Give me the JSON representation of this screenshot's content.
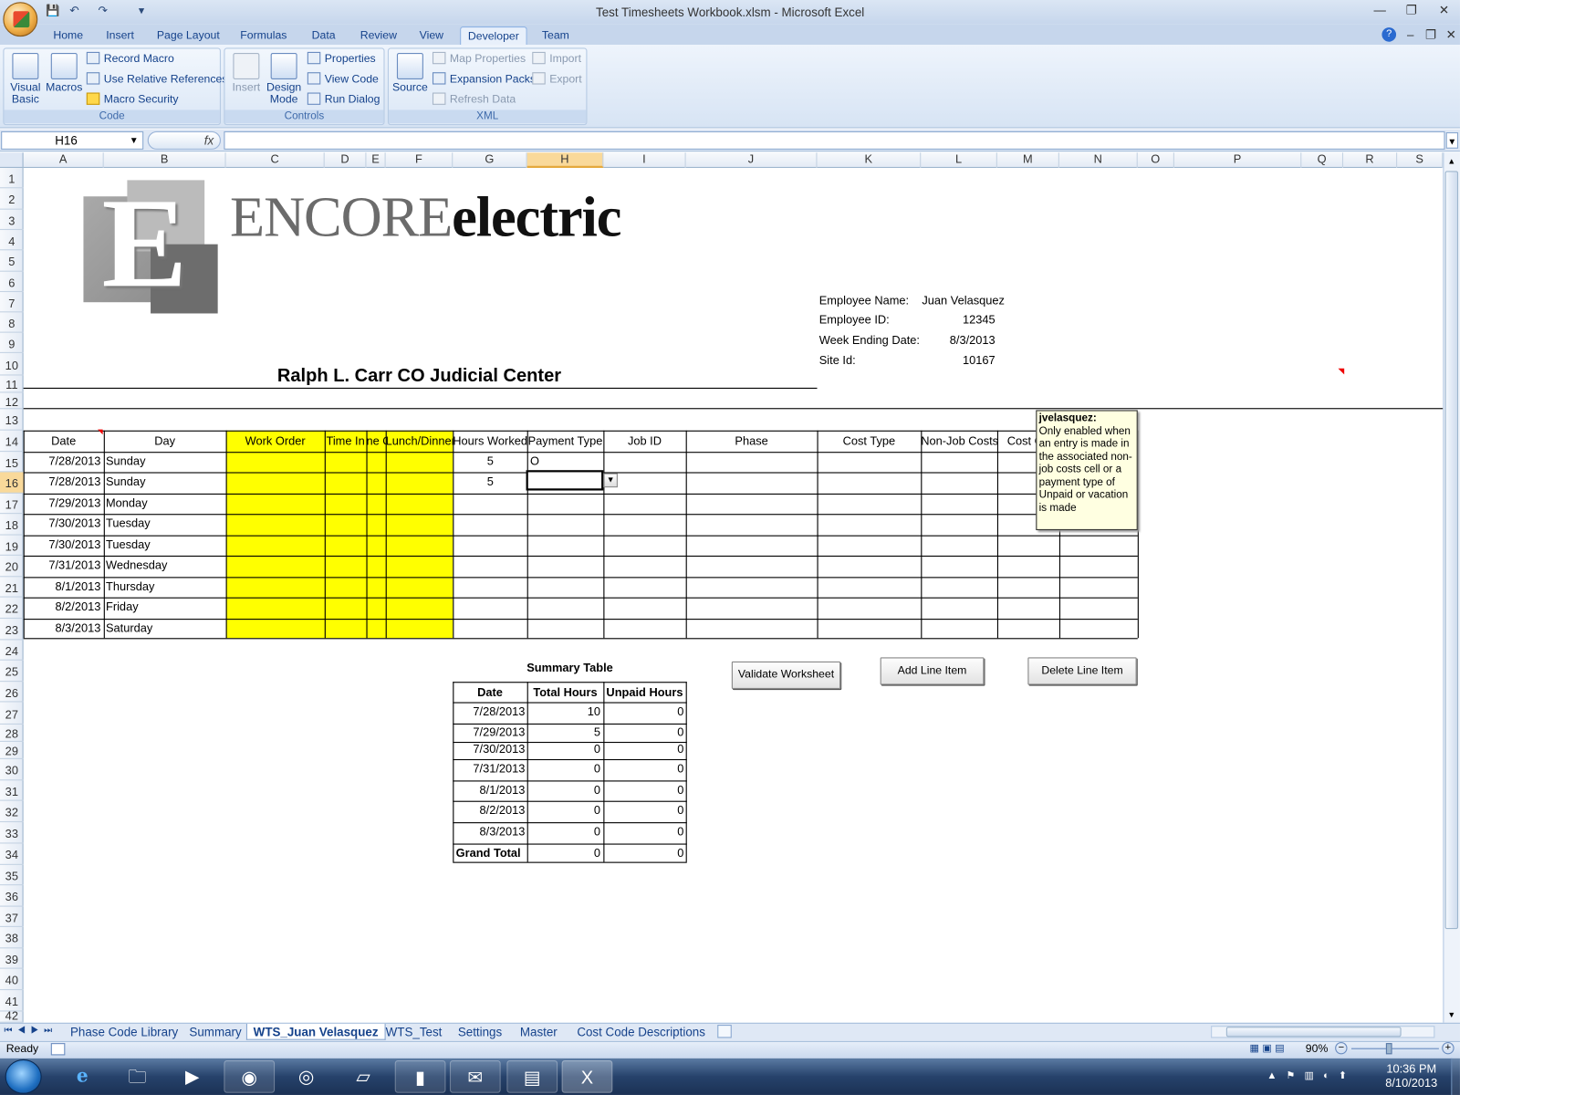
{
  "window": {
    "title": "Test Timesheets Workbook.xlsm - Microsoft Excel"
  },
  "ribbon_tabs": [
    "Home",
    "Insert",
    "Page Layout",
    "Formulas",
    "Data",
    "Review",
    "View",
    "Developer",
    "Team"
  ],
  "active_tab": "Developer",
  "ribbon": {
    "code": {
      "label": "Code",
      "visual_basic": "Visual Basic",
      "macros": "Macros",
      "record_macro": "Record Macro",
      "use_relative": "Use Relative References",
      "macro_security": "Macro Security"
    },
    "controls": {
      "label": "Controls",
      "insert": "Insert",
      "design_mode": "Design Mode",
      "properties": "Properties",
      "view_code": "View Code",
      "run_dialog": "Run Dialog"
    },
    "xml": {
      "label": "XML",
      "source": "Source",
      "map_properties": "Map Properties",
      "expansion_packs": "Expansion Packs",
      "refresh_data": "Refresh Data",
      "import": "Import",
      "export": "Export"
    }
  },
  "formula_bar": {
    "name_box": "H16",
    "fx": "fx",
    "value": ""
  },
  "columns": [
    "A",
    "B",
    "C",
    "D",
    "E",
    "F",
    "G",
    "H",
    "I",
    "J",
    "K",
    "L",
    "M",
    "N",
    "O",
    "P",
    "Q",
    "R",
    "S"
  ],
  "selected_column": "H",
  "rows": [
    "1",
    "2",
    "3",
    "4",
    "5",
    "6",
    "7",
    "8",
    "9",
    "10",
    "11",
    "12",
    "13",
    "14",
    "15",
    "16",
    "17",
    "18",
    "19",
    "20",
    "21",
    "22",
    "23",
    "24",
    "25",
    "26",
    "27",
    "28",
    "29",
    "30",
    "31",
    "32",
    "33",
    "34",
    "35",
    "36",
    "37",
    "38",
    "39",
    "40",
    "41",
    "42"
  ],
  "selected_row": "16",
  "logo": {
    "letter": "E",
    "word1": "ENCORE",
    "word2": "electric"
  },
  "employee": {
    "name_label": "Employee Name:",
    "name_value": "Juan Velasquez",
    "id_label": "Employee ID:",
    "id_value": "12345",
    "week_label": "Week Ending Date:",
    "week_value": "8/3/2013",
    "site_label": "Site Id:",
    "site_value": "10167"
  },
  "project_title": "Ralph L. Carr CO Judicial Center",
  "timesheet": {
    "headers": [
      "Date",
      "Day",
      "Work Order",
      "Time In",
      "ne O",
      "Lunch/Dinner",
      "Hours Worked",
      "Payment Type",
      "Job ID",
      "Phase",
      "Cost Type",
      "Non-Job Costs",
      "Cost Ce",
      ""
    ],
    "rows": [
      {
        "date": "7/28/2013",
        "day": "Sunday",
        "hours": "5",
        "payment": "O"
      },
      {
        "date": "7/28/2013",
        "day": "Sunday",
        "hours": "5",
        "payment": ""
      },
      {
        "date": "7/29/2013",
        "day": "Monday",
        "hours": "",
        "payment": ""
      },
      {
        "date": "7/30/2013",
        "day": "Tuesday",
        "hours": "",
        "payment": ""
      },
      {
        "date": "7/30/2013",
        "day": "Tuesday",
        "hours": "",
        "payment": ""
      },
      {
        "date": "7/31/2013",
        "day": "Wednesday",
        "hours": "",
        "payment": ""
      },
      {
        "date": "8/1/2013",
        "day": "Thursday",
        "hours": "",
        "payment": ""
      },
      {
        "date": "8/2/2013",
        "day": "Friday",
        "hours": "",
        "payment": ""
      },
      {
        "date": "8/3/2013",
        "day": "Saturday",
        "hours": "",
        "payment": ""
      }
    ]
  },
  "comment": {
    "author": "jvelasquez:",
    "text": "Only enabled when an entry is made in the associated non-job costs cell or a payment type of Unpaid or vacation is made"
  },
  "summary": {
    "title": "Summary Table",
    "headers": [
      "Date",
      "Total Hours",
      "Unpaid Hours"
    ],
    "rows": [
      {
        "date": "7/28/2013",
        "total": "10",
        "unpaid": "0"
      },
      {
        "date": "7/29/2013",
        "total": "5",
        "unpaid": "0"
      },
      {
        "date": "7/30/2013",
        "total": "0",
        "unpaid": "0"
      },
      {
        "date": "7/31/2013",
        "total": "0",
        "unpaid": "0"
      },
      {
        "date": "8/1/2013",
        "total": "0",
        "unpaid": "0"
      },
      {
        "date": "8/2/2013",
        "total": "0",
        "unpaid": "0"
      },
      {
        "date": "8/3/2013",
        "total": "0",
        "unpaid": "0"
      }
    ],
    "grand_total_label": "Grand Total",
    "grand_total_hours": "0",
    "grand_total_unpaid": "0"
  },
  "buttons": {
    "validate": "Validate Worksheet",
    "add": "Add Line Item",
    "delete": "Delete Line Item"
  },
  "sheet_tabs": [
    "Phase Code Library",
    "Summary",
    "WTS_Juan Velasquez",
    "WTS_Test",
    "Settings",
    "Master",
    "Cost Code Descriptions"
  ],
  "active_sheet": "WTS_Juan Velasquez",
  "status": {
    "ready": "Ready",
    "zoom": "90%"
  },
  "clock": {
    "time": "10:36 PM",
    "date": "8/10/2013"
  },
  "colors": {
    "highlight": "#ffff00",
    "ribbon": "#dbe7f6",
    "selection": "#f9d99a",
    "taskbar": "#26426b"
  }
}
